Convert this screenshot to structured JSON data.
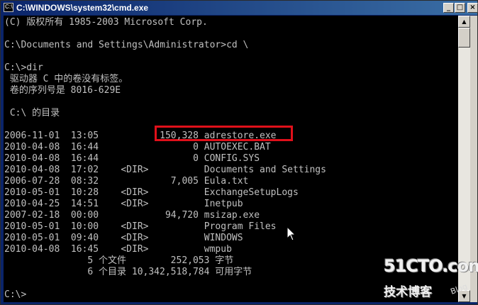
{
  "window": {
    "title": "C:\\WINDOWS\\system32\\cmd.exe",
    "icon": "console-icon",
    "buttons": {
      "minimize": "_",
      "maximize": "□",
      "close": "×"
    }
  },
  "console": {
    "lines": [
      "(C) 版权所有 1985-2003 Microsoft Corp.",
      "",
      "C:\\Documents and Settings\\Administrator>cd \\",
      "",
      "C:\\>dir",
      " 驱动器 C 中的卷没有标签。",
      " 卷的序列号是 8016-629E",
      "",
      " C:\\ 的目录",
      "",
      "2006-11-01  13:05           150,328 adrestore.exe",
      "2010-04-08  16:44                 0 AUTOEXEC.BAT",
      "2010-04-08  16:44                 0 CONFIG.SYS",
      "2010-04-08  17:02    <DIR>          Documents and Settings",
      "2006-07-28  08:32             7,005 Eula.txt",
      "2010-05-01  10:28    <DIR>          ExchangeSetupLogs",
      "2010-04-25  14:51    <DIR>          Inetpub",
      "2007-02-18  00:00            94,720 msizap.exe",
      "2010-05-01  10:00    <DIR>          Program Files",
      "2010-05-01  09:40    <DIR>          WINDOWS",
      "2010-04-08  16:45    <DIR>          wmpub",
      "               5 个文件        252,053 字节",
      "               6 个目录 10,342,518,784 可用字节",
      "",
      "C:\\>"
    ],
    "highlighted_entry": "150,328 adrestore.exe",
    "highlight_color": "#e0101a",
    "text_color": "#c0c0c0",
    "background_color": "#000000"
  },
  "watermark": {
    "logo": "51CTO.com",
    "subtitle": "技术博客",
    "blog": "Blog"
  },
  "colors": {
    "titlebar_start": "#0a246a",
    "titlebar_end": "#3a6ea5",
    "frame": "#d4d0c8"
  }
}
